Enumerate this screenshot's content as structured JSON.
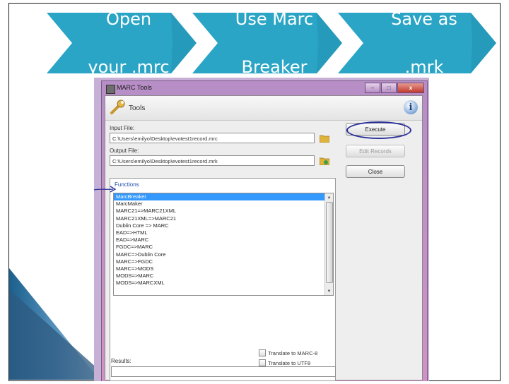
{
  "steps": [
    {
      "line1": "Open",
      "line2": "your .mrc"
    },
    {
      "line1": "Use Marc",
      "line2": "Breaker"
    },
    {
      "line1": "Save as",
      "line2": ".mrk"
    }
  ],
  "colors": {
    "arrow": "#2aa5c6",
    "arrow_dark": "#1d88a6",
    "selection": "#3399ff",
    "annotation": "#2a2f9a",
    "window_frame": "#c99ad0"
  },
  "window": {
    "title": "MARC Tools",
    "controls": {
      "minimize": "–",
      "maximize": "□",
      "close": "x"
    },
    "toolbar": {
      "label": "Tools",
      "info_icon": "i"
    },
    "input_file": {
      "label": "Input File:",
      "value": "C:\\Users\\emilyo\\Desktop\\evotest1record.mrc"
    },
    "output_file": {
      "label": "Output File:",
      "value": "C:\\Users\\emilyo\\Desktop\\evotest1record.mrk"
    },
    "buttons": {
      "execute": "Execute",
      "edit_records": "Edit Records",
      "close": "Close"
    },
    "functions": {
      "title": "Functions",
      "items": [
        "MarcBreaker",
        "MarcMaker",
        "MARC21=>MARC21XML",
        "MARC21XML=>MARC21",
        "Dublin Core => MARC",
        "EAD=>HTML",
        "EAD=>MARC",
        "FGDC=>MARC",
        "MARC=>Dublin Core",
        "MARC=>FGDC",
        "MARC=>MODS",
        "MODS=>MARC",
        "MODS=>MARCXML"
      ],
      "selected": "MarcBreaker"
    },
    "options": {
      "translate_marc8": "Translate to MARC-8",
      "translate_utf8": "Translate to UTF8"
    },
    "results": {
      "label": "Results:",
      "value": ""
    }
  }
}
